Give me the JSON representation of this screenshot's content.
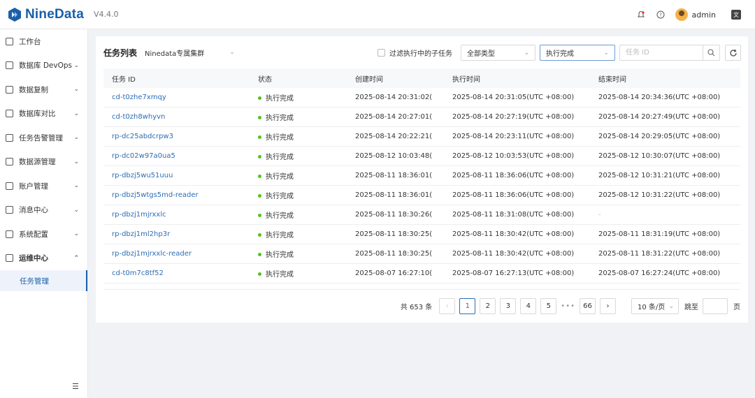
{
  "header": {
    "brand": "NineData",
    "version": "V4.4.0",
    "username": "admin"
  },
  "sidebar": {
    "items": [
      {
        "label": "工作台",
        "expandable": false
      },
      {
        "label": "数据库 DevOps",
        "expandable": true
      },
      {
        "label": "数据复制",
        "expandable": true
      },
      {
        "label": "数据库对比",
        "expandable": true
      },
      {
        "label": "任务告警管理",
        "expandable": true
      },
      {
        "label": "数据源管理",
        "expandable": true
      },
      {
        "label": "账户管理",
        "expandable": true
      },
      {
        "label": "消息中心",
        "expandable": true
      },
      {
        "label": "系统配置",
        "expandable": true
      },
      {
        "label": "运维中心",
        "expandable": true,
        "expanded": true
      }
    ],
    "active_sub": "任务管理"
  },
  "toolbar": {
    "title": "任务列表",
    "cluster": "Ninedata专属集群",
    "filter_subtasks_label": "过滤执行中的子任务",
    "type_select": "全部类型",
    "status_select": "执行完成",
    "search_placeholder": "任务 ID"
  },
  "table": {
    "columns": [
      "任务 ID",
      "状态",
      "创建时间",
      "执行时间",
      "结束时间"
    ],
    "rows": [
      {
        "id": "cd-t0zhe7xmqy",
        "status": "执行完成",
        "created": "2025-08-14 20:31:02(",
        "exec": "2025-08-14 20:31:05(UTC +08:00)",
        "end": "2025-08-14 20:34:36(UTC +08:00)"
      },
      {
        "id": "cd-t0zh8whyvn",
        "status": "执行完成",
        "created": "2025-08-14 20:27:01(",
        "exec": "2025-08-14 20:27:19(UTC +08:00)",
        "end": "2025-08-14 20:27:49(UTC +08:00)"
      },
      {
        "id": "rp-dc25abdcrpw3",
        "status": "执行完成",
        "created": "2025-08-14 20:22:21(",
        "exec": "2025-08-14 20:23:11(UTC +08:00)",
        "end": "2025-08-14 20:29:05(UTC +08:00)"
      },
      {
        "id": "rp-dc02w97a0ua5",
        "status": "执行完成",
        "created": "2025-08-12 10:03:48(",
        "exec": "2025-08-12 10:03:53(UTC +08:00)",
        "end": "2025-08-12 10:30:07(UTC +08:00)"
      },
      {
        "id": "rp-dbzj5wu51uuu",
        "status": "执行完成",
        "created": "2025-08-11 18:36:01(",
        "exec": "2025-08-11 18:36:06(UTC +08:00)",
        "end": "2025-08-12 10:31:21(UTC +08:00)"
      },
      {
        "id": "rp-dbzj5wtgs5md-reader",
        "status": "执行完成",
        "created": "2025-08-11 18:36:01(",
        "exec": "2025-08-11 18:36:06(UTC +08:00)",
        "end": "2025-08-12 10:31:22(UTC +08:00)"
      },
      {
        "id": "rp-dbzj1mjrxxlc",
        "status": "执行完成",
        "created": "2025-08-11 18:30:26(",
        "exec": "2025-08-11 18:31:08(UTC +08:00)",
        "end": "-"
      },
      {
        "id": "rp-dbzj1ml2hp3r",
        "status": "执行完成",
        "created": "2025-08-11 18:30:25(",
        "exec": "2025-08-11 18:30:42(UTC +08:00)",
        "end": "2025-08-11 18:31:19(UTC +08:00)"
      },
      {
        "id": "rp-dbzj1mjrxxlc-reader",
        "status": "执行完成",
        "created": "2025-08-11 18:30:25(",
        "exec": "2025-08-11 18:30:42(UTC +08:00)",
        "end": "2025-08-11 18:31:22(UTC +08:00)"
      },
      {
        "id": "cd-t0m7c8tf52",
        "status": "执行完成",
        "created": "2025-08-07 16:27:10(",
        "exec": "2025-08-07 16:27:13(UTC +08:00)",
        "end": "2025-08-07 16:27:24(UTC +08:00)"
      }
    ]
  },
  "pagination": {
    "total": "共 653 条",
    "pages": [
      "1",
      "2",
      "3",
      "4",
      "5"
    ],
    "current": "1",
    "ellipsis": "•••",
    "last": "66",
    "page_size": "10 条/页",
    "jump_label": "跳至",
    "page_unit": "页"
  },
  "colors": {
    "brand": "#1a5fa8",
    "link": "#2d6db5",
    "success_dot": "#52c41a"
  },
  "icons": {
    "refresh": "refresh-icon",
    "search": "search-icon",
    "notification": "bell-icon",
    "help": "help-icon",
    "language": "language-icon"
  }
}
